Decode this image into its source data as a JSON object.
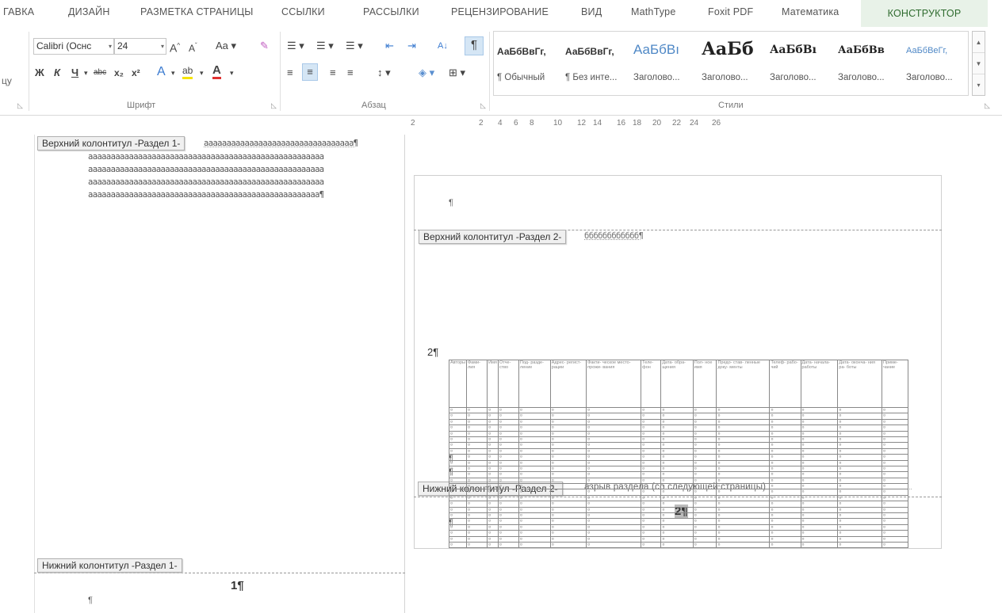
{
  "ribbon_tabs": [
    {
      "label": "ГАВКА"
    },
    {
      "label": "ДИЗАЙН"
    },
    {
      "label": "РАЗМЕТКА СТРАНИЦЫ"
    },
    {
      "label": "ССЫЛКИ"
    },
    {
      "label": "РАССЫЛКИ"
    },
    {
      "label": "РЕЦЕНЗИРОВАНИЕ"
    },
    {
      "label": "ВИД"
    },
    {
      "label": "MathType"
    },
    {
      "label": "Foxit PDF"
    },
    {
      "label": "Математика"
    },
    {
      "label": "КОНСТРУКТОР"
    }
  ],
  "ribbon": {
    "left_cut_label": "цу",
    "font": {
      "group_label": "Шрифт",
      "font_name": "Calibri (Оснс",
      "font_size": "24",
      "grow_font": "A",
      "shrink_font": "A",
      "change_case": "Aa",
      "bold": "Ж",
      "italic": "К",
      "underline": "Ч",
      "strikethrough": "abc",
      "subscript": "x₂",
      "superscript": "x²",
      "text_effects": "A",
      "highlight": "ab",
      "font_color": "A"
    },
    "paragraph": {
      "group_label": "Абзац",
      "pilcrow": "¶"
    },
    "styles": {
      "group_label": "Стили",
      "items": [
        {
          "preview": "АаБбВвГг,",
          "name": "¶ Обычный"
        },
        {
          "preview": "АаБбВвГг,",
          "name": "¶ Без инте..."
        },
        {
          "preview": "АаБбВı",
          "name": "Заголово..."
        },
        {
          "preview": "АаБб",
          "name": "Заголово..."
        },
        {
          "preview": "АаБбВı",
          "name": "Заголово..."
        },
        {
          "preview": "АаБбВв",
          "name": "Заголово..."
        },
        {
          "preview": "АаБбВеГг,",
          "name": "Заголово..."
        }
      ]
    }
  },
  "ruler": {
    "labels": [
      "2",
      "2",
      "4",
      "6",
      "8",
      "10",
      "12",
      "14",
      "16",
      "18",
      "20",
      "22",
      "24",
      "26"
    ]
  },
  "page1": {
    "header_tag": "Верхний колонтитул -Раздел 1-",
    "first_line": "ааааааааааааааааааааааааааааааааа¶",
    "body_lines": [
      "аааааааааааааааааааааааааааааааааааааааааааааааааааа",
      "аааааааааааааааааааааааааааааааааааааааааааааааааааа",
      "аааааааааааааааааааааааааааааааааааааааааааааааааааа",
      "ааааааааааааааааааааааааааааааааааааааааааааааааааа¶"
    ],
    "footer_tag": "Нижний колонтитул -Раздел 1-",
    "page_number": "1¶",
    "footer_mark": "¶"
  },
  "page2": {
    "top_mark": "¶",
    "header_tag": "Верхний колонтитул -Раздел 2-",
    "header_text": "бббббббббббб¶",
    "side_number": "2¶",
    "table_headers": [
      "Авторы",
      "Фами- лия",
      "Имя",
      "Отче- ство",
      "Под- разде- ление",
      "Адрес- регист- рации",
      "Факти- ческое место- прожи- вания",
      "Теле- фон",
      "Дата- обра- щения",
      "Пол- ное имя",
      "Предо- став- ленные доку- менты",
      "Телеф- рабо- чий",
      "Дата- начала- работы",
      "Дата- оконча- ния ра- боты",
      "Приме- чание"
    ],
    "row_count": 24,
    "cell_mark": "¤",
    "after_table_marks": [
      "¶",
      "¶"
    ],
    "section_break": "азрыв раздела (со следующей страницы)",
    "footer_tag": "Нижний колонтитул -Раздел 2-",
    "page_number": "2¶",
    "footer_mark": "¶"
  }
}
